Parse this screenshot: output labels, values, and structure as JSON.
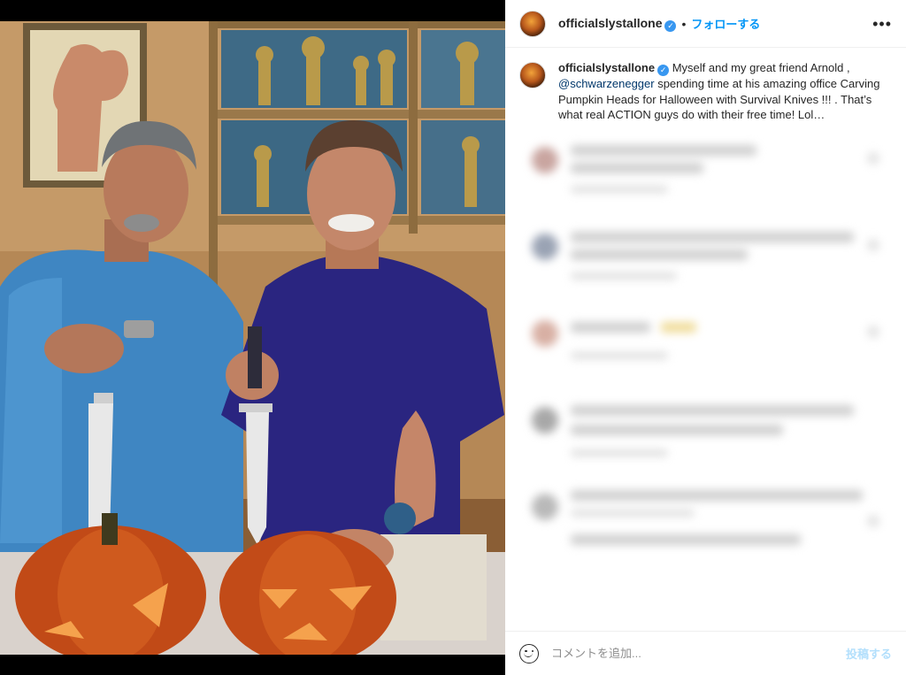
{
  "post": {
    "username": "officialslystallone",
    "verified_mark": "✓",
    "separator": "•",
    "follow_label": "フォローする",
    "more_icon": "more-options-icon"
  },
  "caption": {
    "username": "officialslystallone",
    "text_before_mention": " Myself and my great friend Arnold ,",
    "mention": "@schwarzenegger",
    "text_after_mention": " spending time at his amazing office Carving Pumpkin Heads for Halloween with Survival Knives !!! . That’s what real ACTION guys do with their free time! Lol…"
  },
  "add_comment": {
    "placeholder": "コメントを追加...",
    "post_label": "投稿する",
    "emoji_icon": "emoji-icon"
  },
  "colors": {
    "link_blue": "#0095f6",
    "mention_blue": "#00376b",
    "post_disabled": "#b2dffc",
    "text": "#262626",
    "muted": "#8e8e8e"
  }
}
